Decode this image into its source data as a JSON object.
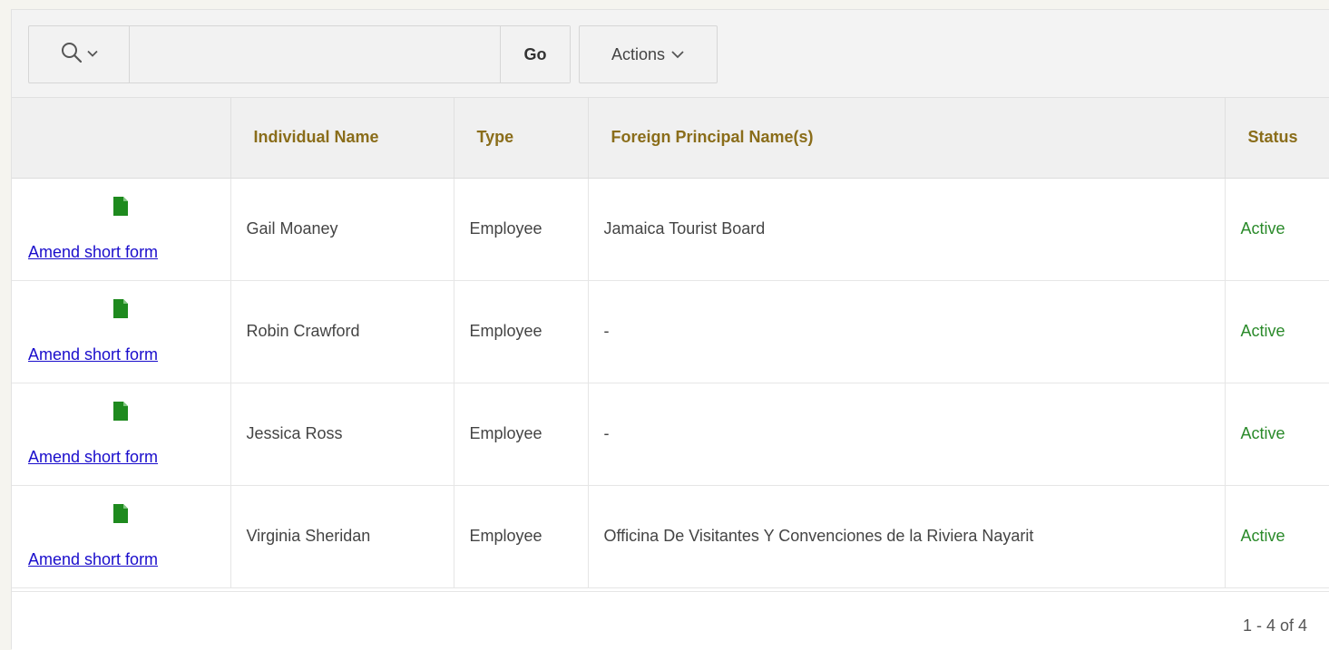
{
  "toolbar": {
    "search": {
      "value": "",
      "placeholder": ""
    },
    "go_label": "Go",
    "actions_label": "Actions"
  },
  "table": {
    "columns": [
      "",
      "Individual Name",
      "Type",
      "Foreign Principal Name(s)",
      "Status"
    ],
    "rows": [
      {
        "action": "Amend short form",
        "name": "Gail Moaney",
        "type": "Employee",
        "principal": "Jamaica Tourist Board",
        "status": "Active"
      },
      {
        "action": "Amend short form",
        "name": "Robin Crawford",
        "type": "Employee",
        "principal": "-",
        "status": "Active"
      },
      {
        "action": "Amend short form",
        "name": "Jessica Ross",
        "type": "Employee",
        "principal": "-",
        "status": "Active"
      },
      {
        "action": "Amend short form",
        "name": "Virginia Sheridan",
        "type": "Employee",
        "principal": "Officina De Visitantes Y Convenciones de la Riviera Nayarit",
        "status": "Active"
      }
    ]
  },
  "pagination": {
    "label": "1 - 4 of 4"
  },
  "icons": {
    "search": "search-icon",
    "chevron": "chevron-down-icon",
    "document": "document-icon"
  },
  "colors": {
    "header_text": "#8a6d1a",
    "status_active": "#2a8a2a",
    "link": "#1a0dcc",
    "doc_icon": "#1e8a1e"
  }
}
